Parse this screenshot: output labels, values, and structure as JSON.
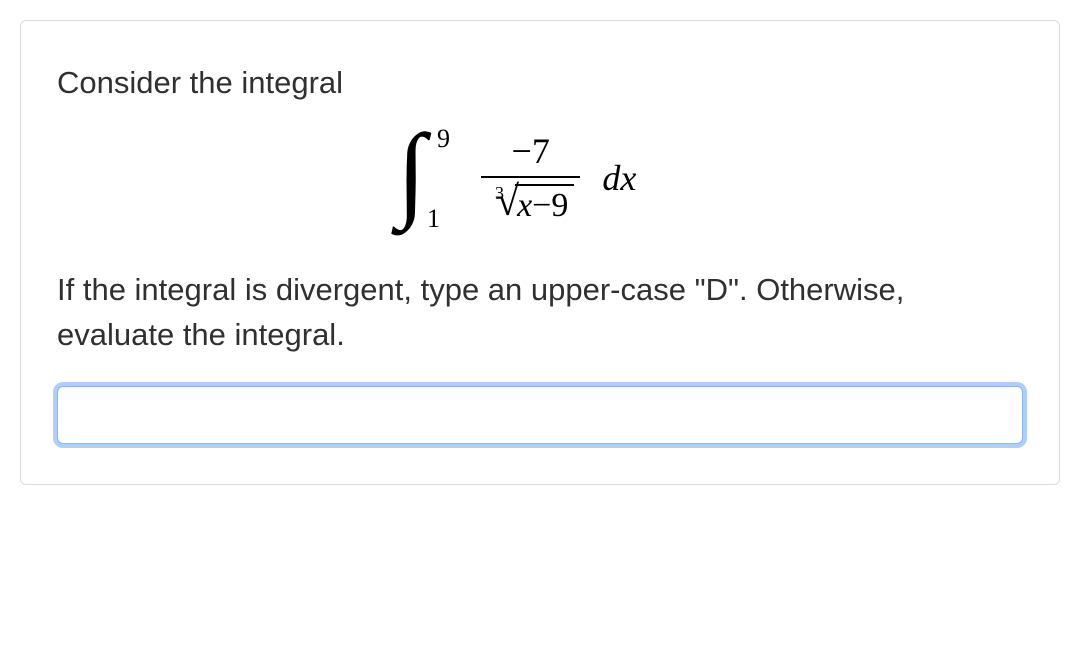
{
  "question": {
    "prompt": "Consider the integral",
    "instruction": "If the integral is divergent, type an upper-case \"D\". Otherwise, evaluate the integral.",
    "integral": {
      "lower_bound": "1",
      "upper_bound": "9",
      "numerator": "−7",
      "root_index": "3",
      "radicand_var": "x",
      "radicand_rest": "−9",
      "differential": "dx"
    },
    "answer_value": "",
    "answer_placeholder": ""
  }
}
